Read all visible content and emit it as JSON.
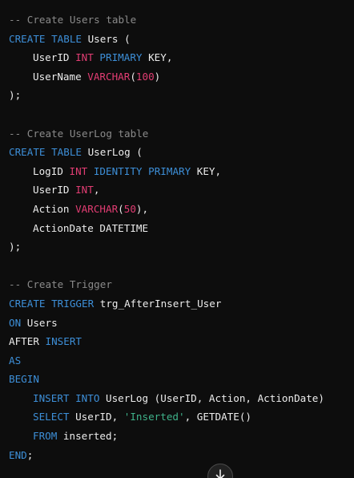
{
  "code": {
    "lines": [
      {
        "indent": false,
        "tokens": [
          {
            "t": "comment",
            "v": "-- Create Users table"
          }
        ]
      },
      {
        "indent": false,
        "tokens": [
          {
            "t": "kw",
            "v": "CREATE"
          },
          {
            "t": "plain",
            "v": " "
          },
          {
            "t": "kw",
            "v": "TABLE"
          },
          {
            "t": "plain",
            "v": " Users ("
          }
        ]
      },
      {
        "indent": true,
        "tokens": [
          {
            "t": "plain",
            "v": "UserID "
          },
          {
            "t": "type",
            "v": "INT"
          },
          {
            "t": "plain",
            "v": " "
          },
          {
            "t": "kw",
            "v": "PRIMARY"
          },
          {
            "t": "plain",
            "v": " KEY,"
          }
        ]
      },
      {
        "indent": true,
        "tokens": [
          {
            "t": "plain",
            "v": "UserName "
          },
          {
            "t": "type",
            "v": "VARCHAR"
          },
          {
            "t": "plain",
            "v": "("
          },
          {
            "t": "num",
            "v": "100"
          },
          {
            "t": "plain",
            "v": ")"
          }
        ]
      },
      {
        "indent": false,
        "tokens": [
          {
            "t": "plain",
            "v": ");"
          }
        ]
      },
      {
        "indent": false,
        "tokens": []
      },
      {
        "indent": false,
        "tokens": [
          {
            "t": "comment",
            "v": "-- Create UserLog table"
          }
        ]
      },
      {
        "indent": false,
        "tokens": [
          {
            "t": "kw",
            "v": "CREATE"
          },
          {
            "t": "plain",
            "v": " "
          },
          {
            "t": "kw",
            "v": "TABLE"
          },
          {
            "t": "plain",
            "v": " UserLog ("
          }
        ]
      },
      {
        "indent": true,
        "tokens": [
          {
            "t": "plain",
            "v": "LogID "
          },
          {
            "t": "type",
            "v": "INT"
          },
          {
            "t": "plain",
            "v": " "
          },
          {
            "t": "kw",
            "v": "IDENTITY"
          },
          {
            "t": "plain",
            "v": " "
          },
          {
            "t": "kw",
            "v": "PRIMARY"
          },
          {
            "t": "plain",
            "v": " KEY,"
          }
        ]
      },
      {
        "indent": true,
        "tokens": [
          {
            "t": "plain",
            "v": "UserID "
          },
          {
            "t": "type",
            "v": "INT"
          },
          {
            "t": "plain",
            "v": ","
          }
        ]
      },
      {
        "indent": true,
        "tokens": [
          {
            "t": "plain",
            "v": "Action "
          },
          {
            "t": "type",
            "v": "VARCHAR"
          },
          {
            "t": "plain",
            "v": "("
          },
          {
            "t": "num",
            "v": "50"
          },
          {
            "t": "plain",
            "v": "),"
          }
        ]
      },
      {
        "indent": true,
        "tokens": [
          {
            "t": "plain",
            "v": "ActionDate DATETIME"
          }
        ]
      },
      {
        "indent": false,
        "tokens": [
          {
            "t": "plain",
            "v": ");"
          }
        ]
      },
      {
        "indent": false,
        "tokens": []
      },
      {
        "indent": false,
        "tokens": [
          {
            "t": "comment",
            "v": "-- Create Trigger"
          }
        ]
      },
      {
        "indent": false,
        "tokens": [
          {
            "t": "kw",
            "v": "CREATE"
          },
          {
            "t": "plain",
            "v": " "
          },
          {
            "t": "kw",
            "v": "TRIGGER"
          },
          {
            "t": "plain",
            "v": " trg_AfterInsert_User"
          }
        ]
      },
      {
        "indent": false,
        "tokens": [
          {
            "t": "kw",
            "v": "ON"
          },
          {
            "t": "plain",
            "v": " Users"
          }
        ]
      },
      {
        "indent": false,
        "tokens": [
          {
            "t": "plain",
            "v": "AFTER "
          },
          {
            "t": "kw",
            "v": "INSERT"
          }
        ]
      },
      {
        "indent": false,
        "tokens": [
          {
            "t": "kw",
            "v": "AS"
          }
        ]
      },
      {
        "indent": false,
        "tokens": [
          {
            "t": "kw",
            "v": "BEGIN"
          }
        ]
      },
      {
        "indent": true,
        "tokens": [
          {
            "t": "kw",
            "v": "INSERT"
          },
          {
            "t": "plain",
            "v": " "
          },
          {
            "t": "kw",
            "v": "INTO"
          },
          {
            "t": "plain",
            "v": " UserLog (UserID, Action, ActionDate)"
          }
        ]
      },
      {
        "indent": true,
        "tokens": [
          {
            "t": "kw",
            "v": "SELECT"
          },
          {
            "t": "plain",
            "v": " UserID, "
          },
          {
            "t": "str",
            "v": "'Inserted'"
          },
          {
            "t": "plain",
            "v": ", GETDATE()"
          }
        ]
      },
      {
        "indent": true,
        "tokens": [
          {
            "t": "kw",
            "v": "FROM"
          },
          {
            "t": "plain",
            "v": " inserted;"
          }
        ]
      },
      {
        "indent": false,
        "tokens": [
          {
            "t": "kw",
            "v": "END"
          },
          {
            "t": "plain",
            "v": ";"
          }
        ]
      }
    ]
  },
  "scroll_button": {
    "icon": "arrow-down-icon"
  },
  "colors": {
    "background": "#0d0d0d",
    "comment": "#8a8a8a",
    "keyword": "#3d8fd8",
    "type": "#e23d73",
    "number": "#e23d73",
    "string": "#3fb28a",
    "plain": "#ececec"
  }
}
